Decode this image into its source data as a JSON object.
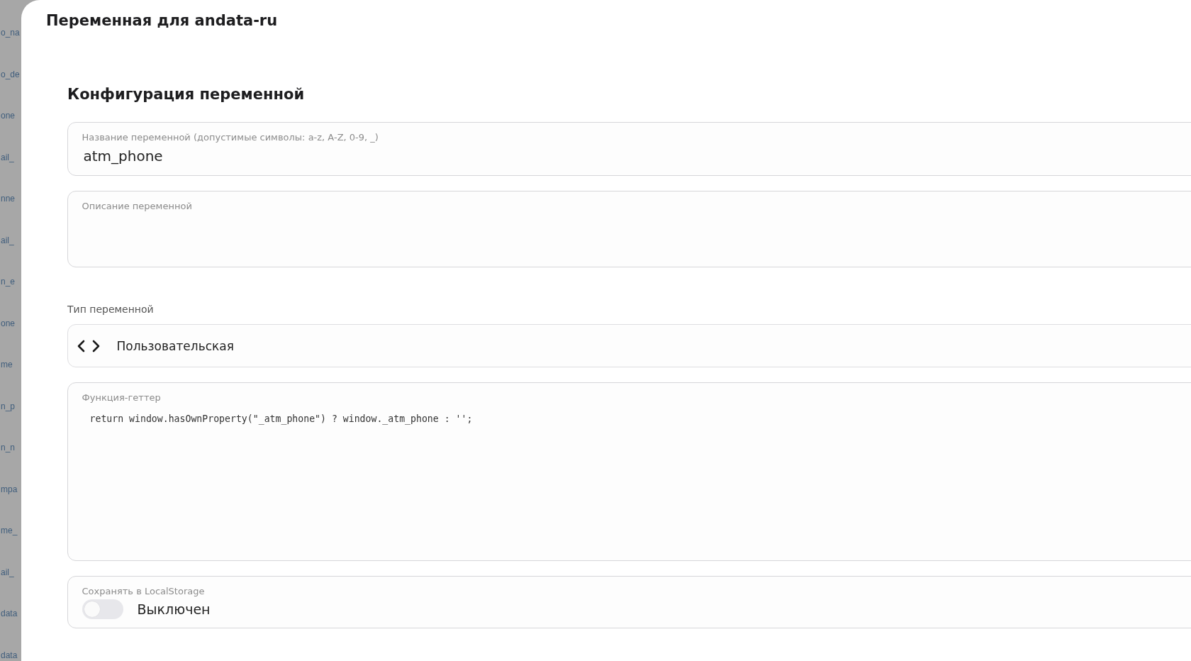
{
  "backdrop_list": {
    "items": [
      "o_na",
      "o_de",
      "one",
      "ail_",
      "nne",
      "ail_",
      "n_e",
      "one",
      "me",
      "n_p",
      "n_n",
      "mpa",
      "me_",
      "ail_",
      "data",
      "data"
    ]
  },
  "panel": {
    "title": "Переменная для andata-ru",
    "section_title": "Конфигурация переменной"
  },
  "fields": [
    {
      "kind": "input",
      "label": "Название переменной (допустимые символы: a-z, A-Z, 0-9, _)",
      "value": "atm_phone"
    },
    {
      "kind": "textarea",
      "label": "Описание переменной"
    },
    {
      "kind": "select",
      "label": "Тип переменной",
      "value": "Пользовательская"
    },
    {
      "kind": "code",
      "label": "Функция-геттер",
      "value": "return window.hasOwnProperty(\"_atm_phone\") ? window._atm_phone : '';"
    },
    {
      "kind": "toggle",
      "label": "Сохранять в LocalStorage",
      "on": false,
      "status": "Выключен"
    }
  ]
}
